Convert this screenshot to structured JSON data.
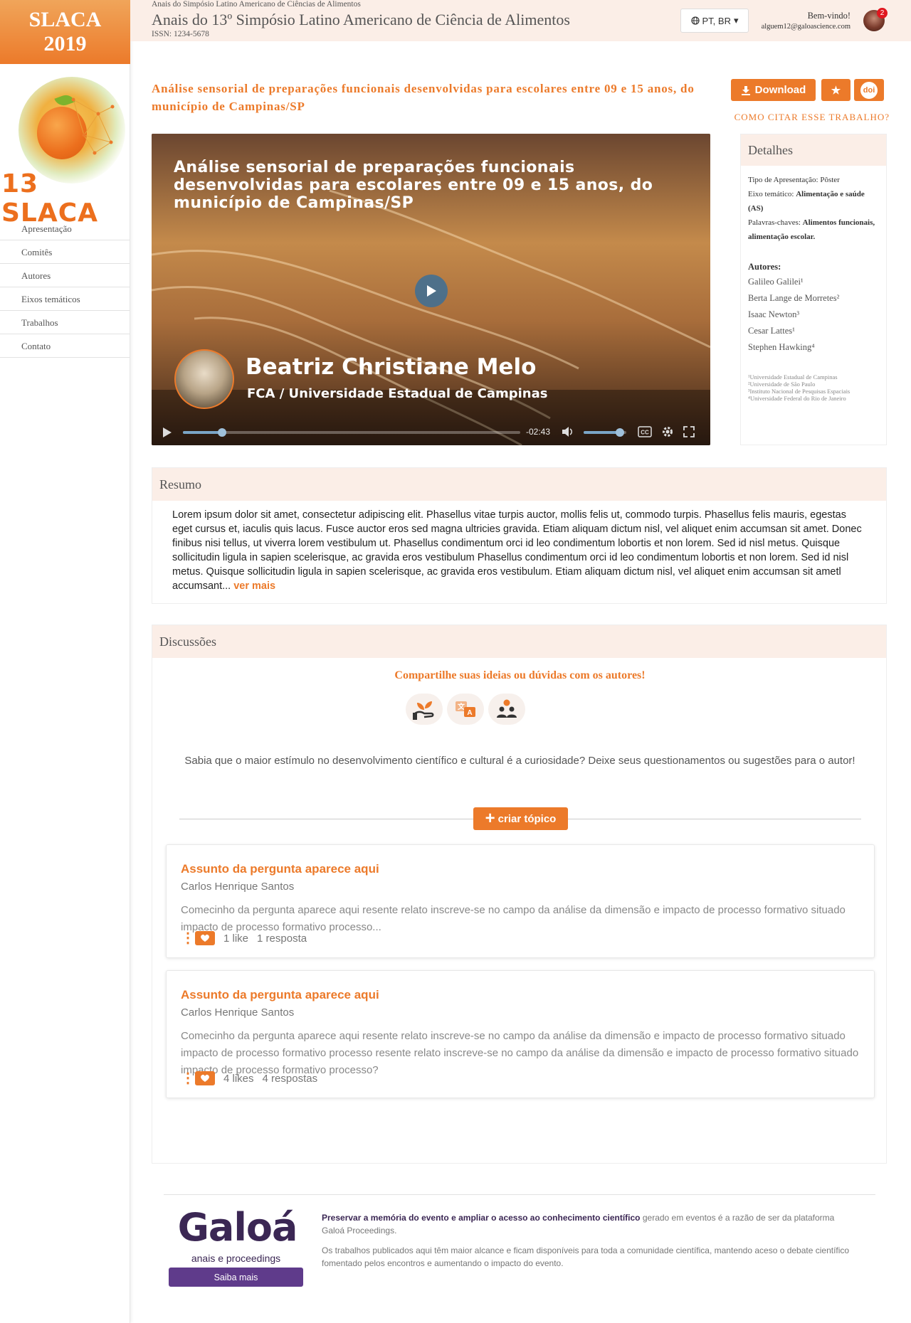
{
  "brand": {
    "line1": "SLACA",
    "line2": "2019",
    "logo_text": "13 SLACA"
  },
  "nav": {
    "items": [
      {
        "label": "Apresentação"
      },
      {
        "label": "Comitês"
      },
      {
        "label": "Autores"
      },
      {
        "label": "Eixos temáticos"
      },
      {
        "label": "Trabalhos"
      },
      {
        "label": "Contato"
      }
    ]
  },
  "header": {
    "small": "Anais do Simpósio Latino Americano de Ciências de Alimentos",
    "title": "Anais do 13º Simpósio Latino Americano de Ciência de Alimentos",
    "issn": "ISSN: 1234-5678",
    "language": "PT, BR",
    "welcome": "Bem-vindo!",
    "email": "alguem12@galoascience.com",
    "notifications": "2"
  },
  "work": {
    "title": "Análise sensorial de preparações funcionais desenvolvidas para escolares entre 09 e 15 anos, do município de Campinas/SP",
    "download_label": "Download",
    "doi_label": "doi",
    "cite_label": "COMO CITAR ESSE TRABALHO?"
  },
  "video": {
    "title": "Análise sensorial de preparações funcionais desenvolvidas para escolares entre 09 e 15 anos, do município de Campinas/SP",
    "presenter": "Beatriz Christiane Melo",
    "institution": "FCA / Universidade Estadual de Campinas",
    "time_remaining": "-02:43",
    "progress": 0.115,
    "volume": 0.85
  },
  "details": {
    "heading": "Detalhes",
    "presentation_label": "Tipo de Apresentação:",
    "presentation_value": "Pôster",
    "axis_label": "Eixo temático:",
    "axis_value": "Alimentação e saúde (AS)",
    "keywords_label": "Palavras-chaves:",
    "keywords_value": "Alimentos funcionais, alimentação escolar.",
    "authors_label": "Autores:",
    "authors": [
      {
        "name": "Galileo Galilei¹"
      },
      {
        "name": "Berta Lange de Morretes²"
      },
      {
        "name": "Isaac Newton³"
      },
      {
        "name": "Cesar Lattes¹"
      },
      {
        "name": "Stephen Hawking⁴"
      }
    ],
    "affiliations": [
      "¹Universidade Estadual de Campinas",
      "²Universidade de São Paulo",
      "³Instituto Nacional de Pesquisas Espaciais",
      "⁴Universidade Federal do Rio de Janeiro"
    ]
  },
  "resumo": {
    "heading": "Resumo",
    "text": "Lorem ipsum dolor sit amet, consectetur adipiscing elit. Phasellus vitae turpis auctor, mollis felis ut, commodo turpis. Phasellus felis mauris, egestas eget cursus et, iaculis quis lacus. Fusce auctor eros sed magna ultricies gravida. Etiam aliquam dictum nisl, vel aliquet enim accumsan sit amet. Donec finibus nisi tellus, ut viverra lorem vestibulum ut. Phasellus condimentum orci id leo condimentum lobortis et non lorem. Sed id nisl metus. Quisque sollicitudin ligula in sapien scelerisque, ac gravida eros vestibulum Phasellus condimentum orci id leo condimentum lobortis et non lorem. Sed id nisl metus. Quisque sollicitudin ligula in sapien scelerisque, ac gravida eros vestibulum. Etiam aliquam dictum nisl, vel aliquet enim accumsan sit ametl accumsant...",
    "more": "ver mais"
  },
  "discussions": {
    "heading": "Discussões",
    "prompt": "Compartilhe suas ideias ou dúvidas com os autores!",
    "intro": "Sabia que o maior estímulo no desenvolvimento científico e cultural é a curiosidade? Deixe seus questionamentos ou sugestões para o autor!",
    "create_label": "criar tópico",
    "topics": [
      {
        "subject": "Assunto da pergunta aparece aqui",
        "author": "Carlos Henrique Santos",
        "excerpt": "Comecinho da pergunta aparece aqui resente relato inscreve-se no campo da análise da dimensão e impacto de processo formativo situado impacto de processo formativo processo...",
        "likes": "1 like",
        "replies": "1 resposta"
      },
      {
        "subject": "Assunto da pergunta aparece aqui",
        "author": "Carlos Henrique Santos",
        "excerpt": "Comecinho da pergunta aparece aqui resente relato inscreve-se no campo da análise da dimensão e impacto de processo formativo situado impacto de processo formativo processo resente relato inscreve-se no campo da análise da dimensão e impacto de processo formativo situado impacto de processo formativo processo?",
        "likes": "4 likes",
        "replies": "4 respostas"
      }
    ]
  },
  "footer": {
    "brand": "Galoá",
    "brand_sub": "anais e proceedings",
    "more_label": "Saiba mais",
    "p1_bold": "Preservar a memória do evento e ampliar o acesso ao conhecimento científico",
    "p1_rest": " gerado em eventos é a razão de ser da plataforma Galoá Proceedings.",
    "p2": "Os trabalhos publicados aqui têm maior alcance e ficam disponíveis para toda a comunidade científica, mantendo aceso o debate científico fomentado pelos encontros e aumentando o impacto do evento."
  },
  "colors": {
    "accent": "#ec7a2a",
    "header_bg": "#fbeee7",
    "galoa_purple": "#5f3b8b"
  }
}
